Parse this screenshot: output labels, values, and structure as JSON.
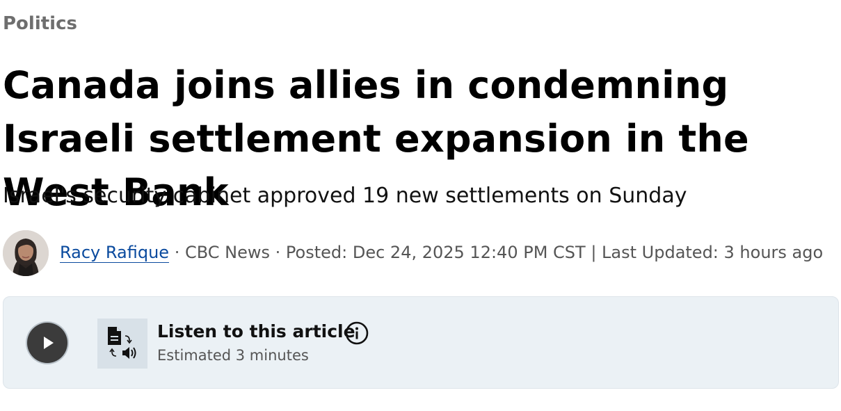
{
  "article": {
    "category": "Politics",
    "headline": "Canada joins allies in condemning Israeli settlement expansion in the West Bank",
    "deck": "Israel's security cabinet approved 19 new settlements on Sunday"
  },
  "byline": {
    "author": "Racy Rafique",
    "outlet": "CBC News",
    "posted_label": "Posted:",
    "posted_date": "Dec 24, 2025 12:40 PM CST",
    "updated_label": "Last Updated:",
    "updated_value": "3 hours ago"
  },
  "audio_player": {
    "title": "Listen to this article",
    "subtitle": "Estimated 3 minutes",
    "icons": {
      "play": "play-icon",
      "tts": "text-to-speech-icon",
      "info": "info-icon"
    }
  },
  "colors": {
    "link": "#0a4a9e",
    "player_bg": "#ebf1f5",
    "category": "#6e6e6e"
  }
}
